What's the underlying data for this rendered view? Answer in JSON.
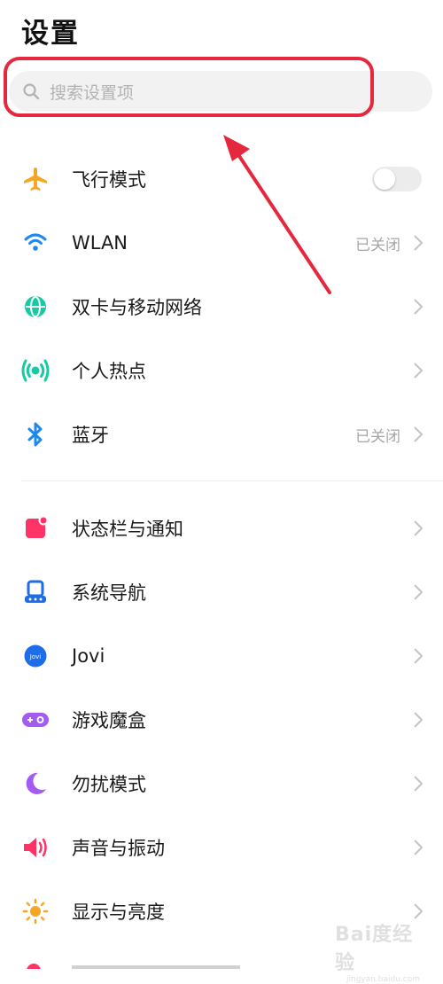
{
  "header": {
    "title": "设置"
  },
  "search": {
    "placeholder": "搜索设置项"
  },
  "colors": {
    "airplane": "#f5a623",
    "wifi": "#1e88f0",
    "dual_sim": "#19c9a3",
    "hotspot": "#19c9a3",
    "bluetooth": "#1e88f0",
    "statusbar": "#ff3366",
    "navigation": "#1e6de8",
    "jovi": "#1e6de8",
    "gamebox": "#a45cf0",
    "dnd": "#a45cf0",
    "sound": "#ff3366",
    "display": "#f5a623",
    "highlight": "#e6283f"
  },
  "group1": [
    {
      "icon": "airplane-icon",
      "label": "飞行模式",
      "control": "toggle",
      "toggle_on": false
    },
    {
      "icon": "wifi-icon",
      "label": "WLAN",
      "status": "已关闭"
    },
    {
      "icon": "globe-icon",
      "label": "双卡与移动网络"
    },
    {
      "icon": "hotspot-icon",
      "label": "个人热点"
    },
    {
      "icon": "bluetooth-icon",
      "label": "蓝牙",
      "status": "已关闭"
    }
  ],
  "group2": [
    {
      "icon": "statusbar-icon",
      "label": "状态栏与通知"
    },
    {
      "icon": "navigation-icon",
      "label": "系统导航"
    },
    {
      "icon": "jovi-icon",
      "label": "Jovi",
      "icon_text": "Jovi"
    },
    {
      "icon": "gamepad-icon",
      "label": "游戏魔盒"
    },
    {
      "icon": "moon-icon",
      "label": "勿扰模式"
    },
    {
      "icon": "speaker-icon",
      "label": "声音与振动"
    },
    {
      "icon": "sun-icon",
      "label": "显示与亮度"
    }
  ],
  "watermark": {
    "line1": "Bai度经验",
    "line2": "jingyan.baidu.com"
  }
}
